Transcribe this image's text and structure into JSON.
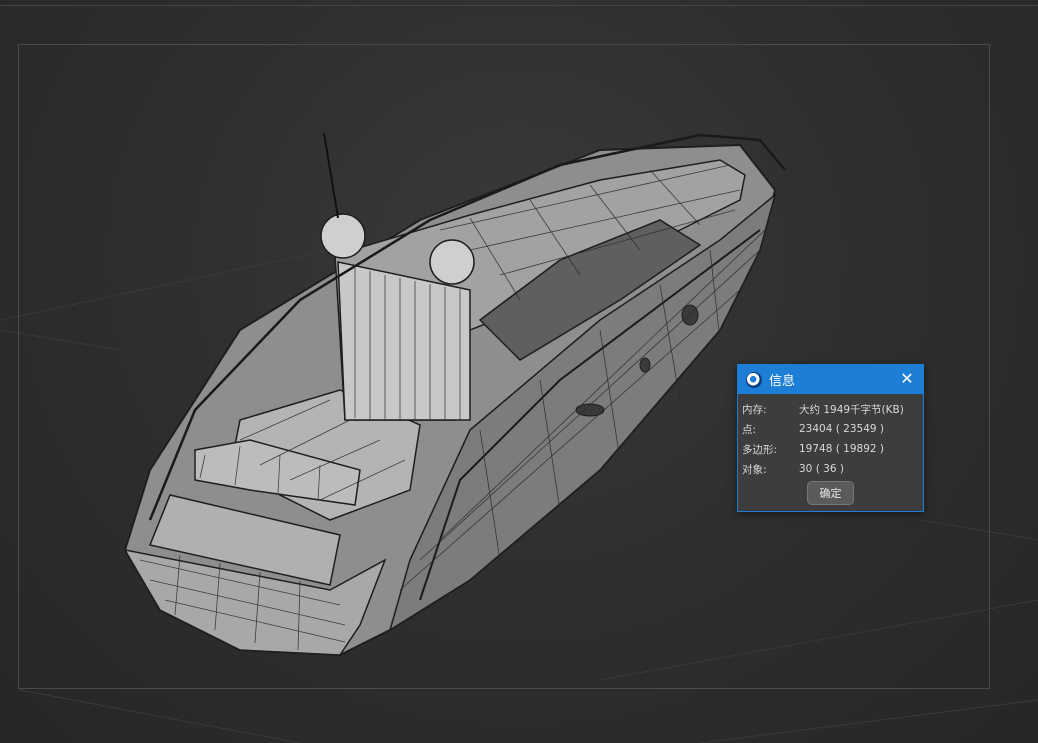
{
  "dialog": {
    "title": "信息",
    "rows": [
      {
        "key": "内存:",
        "value": "大约 1949千字节(KB)"
      },
      {
        "key": "点:",
        "value": "23404 ( 23549 )"
      },
      {
        "key": "多边形:",
        "value": "19748 ( 19892 )"
      },
      {
        "key": "对象:",
        "value": "30 ( 36 )"
      }
    ],
    "ok_label": "确定",
    "close_icon": "close-icon",
    "app_icon": "cinema4d-icon"
  },
  "colors": {
    "title_bar": "#1c7ed4",
    "dialog_bg": "#3d3d3d",
    "viewport_bg": "#2f2f2f",
    "model_fill": "#9a9a9a",
    "wire": "#2a2a2a"
  }
}
